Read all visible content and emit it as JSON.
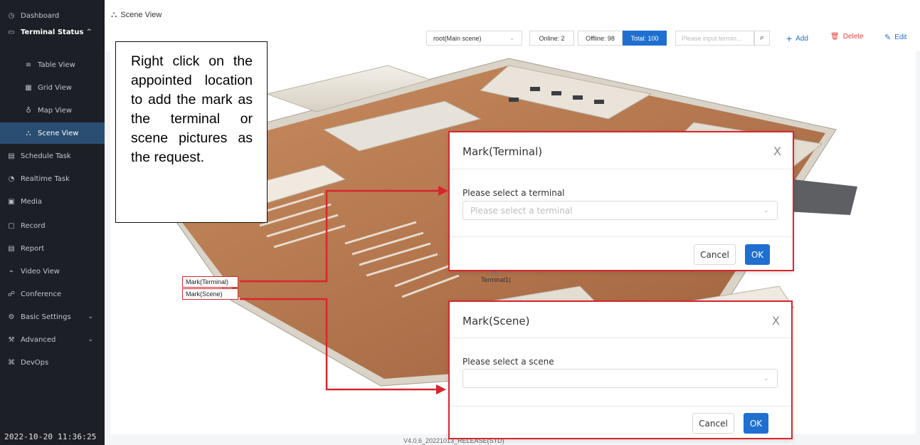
{
  "sidebar": {
    "items": [
      {
        "label": "Dashboard",
        "icon": "dashboard-icon",
        "glyph": "◷"
      },
      {
        "label": "Terminal Status",
        "icon": "monitor-icon",
        "glyph": "▭",
        "expanded_glyph": "^"
      },
      {
        "label": "Table View",
        "icon": "list-icon",
        "glyph": "≡"
      },
      {
        "label": "Grid View",
        "icon": "grid-icon",
        "glyph": "▦"
      },
      {
        "label": "Map View",
        "icon": "map-icon",
        "glyph": "♁"
      },
      {
        "label": "Scene View",
        "icon": "scene-icon",
        "glyph": "⛬"
      },
      {
        "label": "Schedule Task",
        "icon": "calendar-icon",
        "glyph": "▤"
      },
      {
        "label": "Realtime Task",
        "icon": "clock-icon",
        "glyph": "◔"
      },
      {
        "label": "Media",
        "icon": "media-icon",
        "glyph": "▣"
      },
      {
        "label": "Record",
        "icon": "record-icon",
        "glyph": "▢"
      },
      {
        "label": "Report",
        "icon": "report-icon",
        "glyph": "▤"
      },
      {
        "label": "Video View",
        "icon": "video-icon",
        "glyph": "⌁"
      },
      {
        "label": "Conference",
        "icon": "conference-icon",
        "glyph": "☍"
      },
      {
        "label": "Basic Settings",
        "icon": "gear-icon",
        "glyph": "⚙",
        "chev": "⌄"
      },
      {
        "label": "Advanced",
        "icon": "advanced-icon",
        "glyph": "⚒",
        "chev": "⌄"
      },
      {
        "label": "DevOps",
        "icon": "devops-icon",
        "glyph": "⌘"
      }
    ],
    "datetime": "2022-10-20 11:36:25"
  },
  "header": {
    "breadcrumb": "Scene View",
    "breadcrumb_glyph": "⛬"
  },
  "toolbar": {
    "scene_select": "root(Main scene)",
    "online": "Online: 2",
    "offline": "Offline: 98",
    "total": "Total: 100",
    "search_placeholder": "Please input termin...",
    "search_glyph": "⌕",
    "add_label": "Add",
    "add_glyph": "+",
    "delete_label": "Delete",
    "delete_glyph": "🗑",
    "edit_label": "Edit",
    "edit_glyph": "✎",
    "chev_glyph": "⌄"
  },
  "callout": {
    "text": "Right click on the appointed location to add the mark as the terminal or scene pictures as the request."
  },
  "context_menu": {
    "mark_terminal": "Mark(Terminal)",
    "mark_scene": "Mark(Scene)"
  },
  "scene": {
    "terminal_label": "Terminal1("
  },
  "dialog_terminal": {
    "title": "Mark(Terminal)",
    "close": "X",
    "label": "Please select a terminal",
    "placeholder": "Please select a terminal",
    "cancel": "Cancel",
    "ok": "OK"
  },
  "dialog_scene": {
    "title": "Mark(Scene)",
    "close": "X",
    "label": "Please select a scene",
    "placeholder": "",
    "cancel": "Cancel",
    "ok": "OK"
  },
  "footer": {
    "version": "V4.0.6_20221013_RELEASE(STD)"
  },
  "colors": {
    "sidebar_bg": "#1c1f26",
    "active_item": "#2a4d72",
    "primary": "#1f6fd1",
    "delete": "#e64545",
    "annotation_red": "#d8262c"
  }
}
